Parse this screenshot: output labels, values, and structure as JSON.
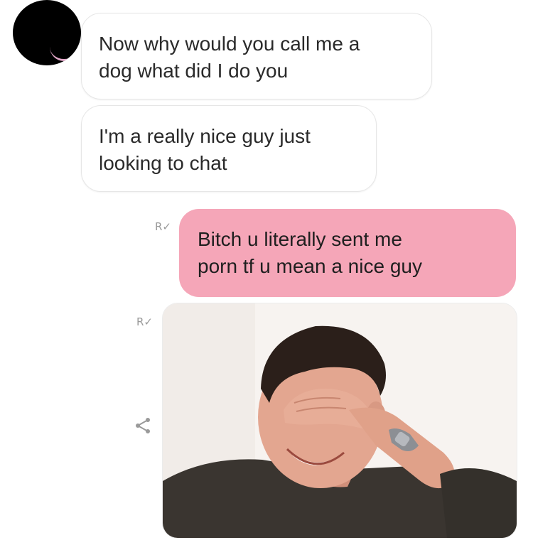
{
  "chat": {
    "contact_avatar_color": "#000000",
    "messages": [
      {
        "direction": "incoming",
        "lines": [
          "Now why would you call me a",
          "dog what did I do you"
        ]
      },
      {
        "direction": "incoming",
        "lines": [
          "I'm a really nice guy just",
          "looking to chat"
        ]
      },
      {
        "direction": "outgoing",
        "lines": [
          "Bitch u literally sent me",
          "porn tf u mean a nice guy"
        ],
        "status": "read"
      },
      {
        "direction": "outgoing",
        "type": "image",
        "image_icon": "man-laughing-facepalm-photo",
        "status": "read"
      }
    ],
    "read_receipt_glyph": "R✓",
    "share_icon": "share-icon",
    "colors": {
      "outgoing_bubble": "#f5a6b8",
      "incoming_bubble": "#ffffff",
      "incoming_border": "#e6e6e6",
      "receipt": "#9a9a9a"
    }
  }
}
